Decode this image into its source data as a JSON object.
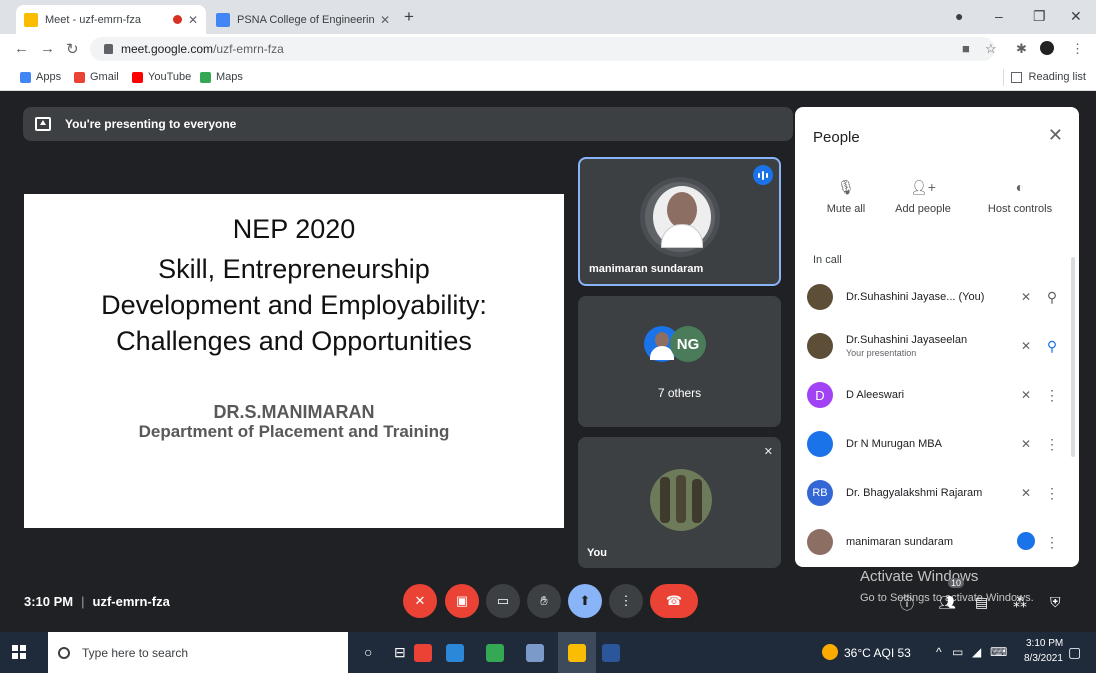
{
  "browser": {
    "tabs": [
      {
        "title": "Meet - uzf-emrn-fza",
        "favicon_color": "#fbbc04"
      },
      {
        "title": "PSNA College of Engineering and",
        "favicon_color": "#4285f4",
        "favicon_text": "8"
      }
    ],
    "new_tab": "+",
    "url_host": "meet.google.com",
    "url_path": "/uzf-emrn-fza",
    "bookmarks": [
      {
        "label": "Apps",
        "color": "#4285f4"
      },
      {
        "label": "Gmail",
        "color": "#ea4335"
      },
      {
        "label": "YouTube",
        "color": "#ff0000"
      },
      {
        "label": "Maps",
        "color": "#34a853"
      }
    ],
    "reading_list": "Reading list"
  },
  "meet": {
    "presenting_banner": "You're presenting to everyone",
    "slide": {
      "line1": "NEP 2020",
      "line2": "Skill, Entrepreneurship",
      "line3": "Development and Employability:",
      "line4": "Challenges and Opportunities",
      "author": "DR.S.MANIMARAN",
      "dept": "Department of Placement and Training"
    },
    "tiles": {
      "speaker_name": "manimaran sundaram",
      "others_label": "7 others",
      "self_label": "You"
    },
    "time": "3:10 PM",
    "meeting_code": "uzf-emrn-fza"
  },
  "people": {
    "title": "People",
    "actions": [
      {
        "label": "Mute all",
        "icon": "mic-off-icon"
      },
      {
        "label": "Add people",
        "icon": "person-add-icon"
      },
      {
        "label": "Host controls",
        "icon": "toggle-icon"
      }
    ],
    "in_call_label": "In call",
    "participants": [
      {
        "name": "Dr.Suhashini Jayase...  (You)",
        "sub": "",
        "avatar_color": "#5d4e37",
        "initial": ""
      },
      {
        "name": "Dr.Suhashini Jayaseelan",
        "sub": "Your presentation",
        "avatar_color": "#5d4e37",
        "initial": ""
      },
      {
        "name": "D Aleeswari",
        "sub": "",
        "avatar_color": "#a142f4",
        "initial": "D"
      },
      {
        "name": "Dr N Murugan MBA",
        "sub": "",
        "avatar_color": "#1a73e8",
        "initial": ""
      },
      {
        "name": "Dr. Bhagyalakshmi Rajaram",
        "sub": "",
        "avatar_color": "#3367d6",
        "initial": "RB"
      },
      {
        "name": "manimaran sundaram",
        "sub": "",
        "avatar_color": "#8d6e63",
        "initial": ""
      }
    ]
  },
  "windows": {
    "activate_title": "Activate Windows",
    "activate_sub": "Go to Settings to activate Windows.",
    "badge": "10",
    "search_placeholder": "Type here to search",
    "weather": "36°C  AQI 53",
    "clock_time": "3:10 PM",
    "clock_date": "8/3/2021"
  }
}
